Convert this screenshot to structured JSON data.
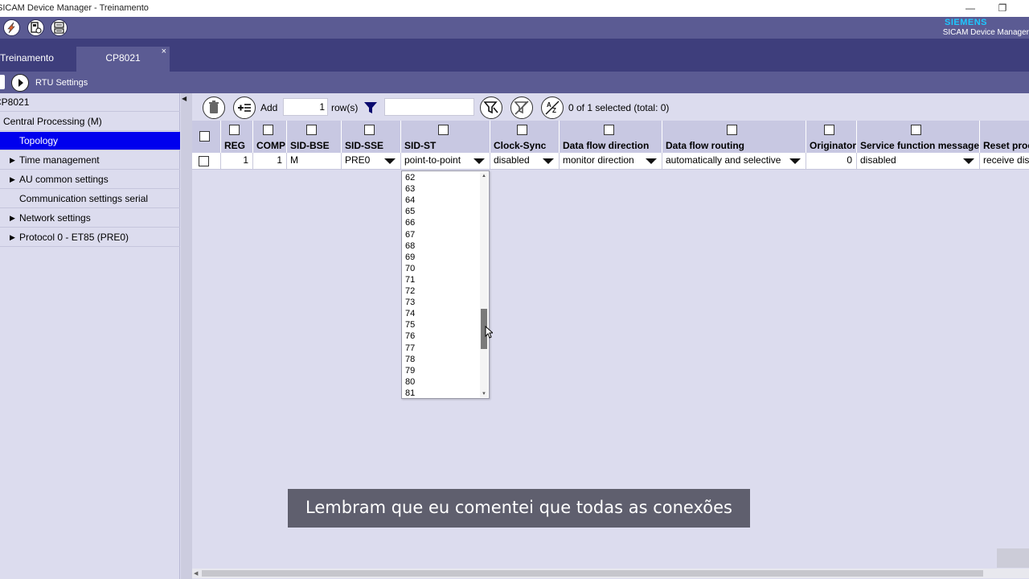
{
  "window": {
    "title": "SICAM Device Manager - Treinamento",
    "minimize": "—",
    "restore": "❐"
  },
  "brand": {
    "logo": "SIEMENS",
    "product": "SICAM Device Manager",
    "logo_color": "#1ec8ff"
  },
  "toolbar": {
    "icons": [
      "edit-icon",
      "device-settings-icon",
      "network-config-icon"
    ]
  },
  "tabs": [
    {
      "label": "Treinamento",
      "active": false
    },
    {
      "label": "CP8021",
      "active": true,
      "close": "×"
    }
  ],
  "breadcrumb": {
    "label": "RTU Settings"
  },
  "sidebar": {
    "root": "CP8021",
    "items": [
      {
        "label": "Central Processing (M)",
        "expandable": false
      },
      {
        "label": "Topology",
        "expandable": false,
        "selected": true
      },
      {
        "label": "Time management",
        "expandable": true
      },
      {
        "label": "AU common settings",
        "expandable": true
      },
      {
        "label": "Communication settings serial",
        "expandable": false
      },
      {
        "label": "Network settings",
        "expandable": true
      },
      {
        "label": "Protocol 0 - ET85 (PRE0)",
        "expandable": true
      }
    ],
    "selected_color": "#0000ee"
  },
  "grid_toolbar": {
    "add_label": "Add",
    "rows_value": "1",
    "rows_label": "row(s)",
    "filter_value": "",
    "selection_status": "0 of 1 selected (total: 0)"
  },
  "table": {
    "columns": [
      "REG",
      "COMP",
      "SID-BSE",
      "SID-SSE",
      "SID-ST",
      "Clock-Sync",
      "Data flow direction",
      "Data flow routing",
      "Originator",
      "Service function messages",
      "Reset process"
    ],
    "row": {
      "reg": "1",
      "comp": "1",
      "sid_bse": "M",
      "sid_sse": "PRE0",
      "sid_st": "point-to-point",
      "clock_sync": "disabled",
      "data_flow_direction": "monitor direction",
      "data_flow_routing": "automatically and selective",
      "originator": "0",
      "service_function_messages": "disabled",
      "reset_process": "receive disabled"
    }
  },
  "dropdown": {
    "items": [
      "62",
      "63",
      "64",
      "65",
      "66",
      "67",
      "68",
      "69",
      "70",
      "71",
      "72",
      "73",
      "74",
      "75",
      "76",
      "77",
      "78",
      "79",
      "80",
      "81"
    ]
  },
  "subtitle": "Lembram que eu comentei que todas as conexões"
}
